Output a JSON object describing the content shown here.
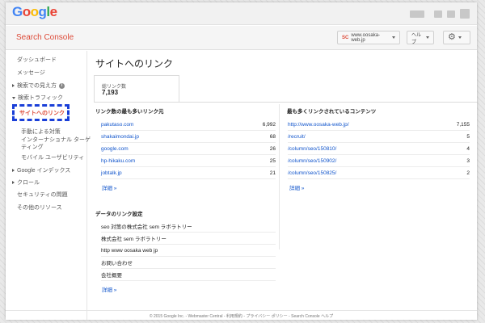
{
  "topbar": {
    "logo_letters": [
      {
        "ch": "G",
        "color": "#4285f4"
      },
      {
        "ch": "o",
        "color": "#ea4335"
      },
      {
        "ch": "o",
        "color": "#fbbc05"
      },
      {
        "ch": "g",
        "color": "#4285f4"
      },
      {
        "ch": "l",
        "color": "#34a853"
      },
      {
        "ch": "e",
        "color": "#ea4335"
      }
    ]
  },
  "header": {
    "product": "Search Console",
    "site_badge": "SC",
    "site": "www.oosaka-web.jp",
    "help": "ヘルプ",
    "settings_icon": "gear-icon"
  },
  "sidebar": {
    "items": [
      {
        "label": "ダッシュボード",
        "expandable": false
      },
      {
        "label": "メッセージ",
        "expandable": false
      },
      {
        "label": "検索での見え方",
        "expandable": true,
        "info": true
      },
      {
        "label": "検索トラフィック",
        "expandable": true,
        "expanded": true
      },
      {
        "label": "サイトへのリンク",
        "selected": true
      },
      {
        "label": "手動による対策"
      },
      {
        "label": "インターナショナル ターゲティング"
      },
      {
        "label": "モバイル ユーザビリティ"
      },
      {
        "label": "Google インデックス",
        "expandable": true
      },
      {
        "label": "クロール",
        "expandable": true
      },
      {
        "label": "セキュリティの問題",
        "expandable": false
      },
      {
        "label": "その他のリソース",
        "expandable": false
      }
    ],
    "intl_line1": "インターナショナル ターゲ",
    "intl_line2": "ティング"
  },
  "main": {
    "title": "サイトへのリンク",
    "total_label": "総リンク数",
    "total_value": "7,193",
    "sources": {
      "title": "リンク数の最も多いリンク元",
      "rows": [
        {
          "domain": "pakutaso.com",
          "count": "6,992"
        },
        {
          "domain": "shakaimondai.jp",
          "count": "68"
        },
        {
          "domain": "google.com",
          "count": "26"
        },
        {
          "domain": "hp-hikaku.com",
          "count": "25"
        },
        {
          "domain": "jobtalk.jp",
          "count": "21"
        }
      ],
      "more": "詳細 »"
    },
    "content": {
      "title": "最も多くリンクされているコンテンツ",
      "rows": [
        {
          "path": "http://www.oosaka-web.jp/",
          "count": "7,155"
        },
        {
          "path": "/recruit/",
          "count": "5"
        },
        {
          "path": "/column/seo/150810/",
          "count": "4"
        },
        {
          "path": "/column/seo/150902/",
          "count": "3"
        },
        {
          "path": "/column/seo/150825/",
          "count": "2"
        }
      ],
      "more": "詳細 »"
    },
    "anchors": {
      "title": "データのリンク設定",
      "rows": [
        "seo 対策の株式会社 sem ラボラトリー",
        "株式会社 sem ラボラトリー",
        "http www oosaka web jp",
        "お問い合わせ",
        "会社概要"
      ],
      "more": "詳細 »"
    }
  },
  "footer": {
    "text": "© 2015 Google Inc. - Webmaster Central - 利用規約 - プライバシー ポリシー - Search Console ヘルプ"
  }
}
